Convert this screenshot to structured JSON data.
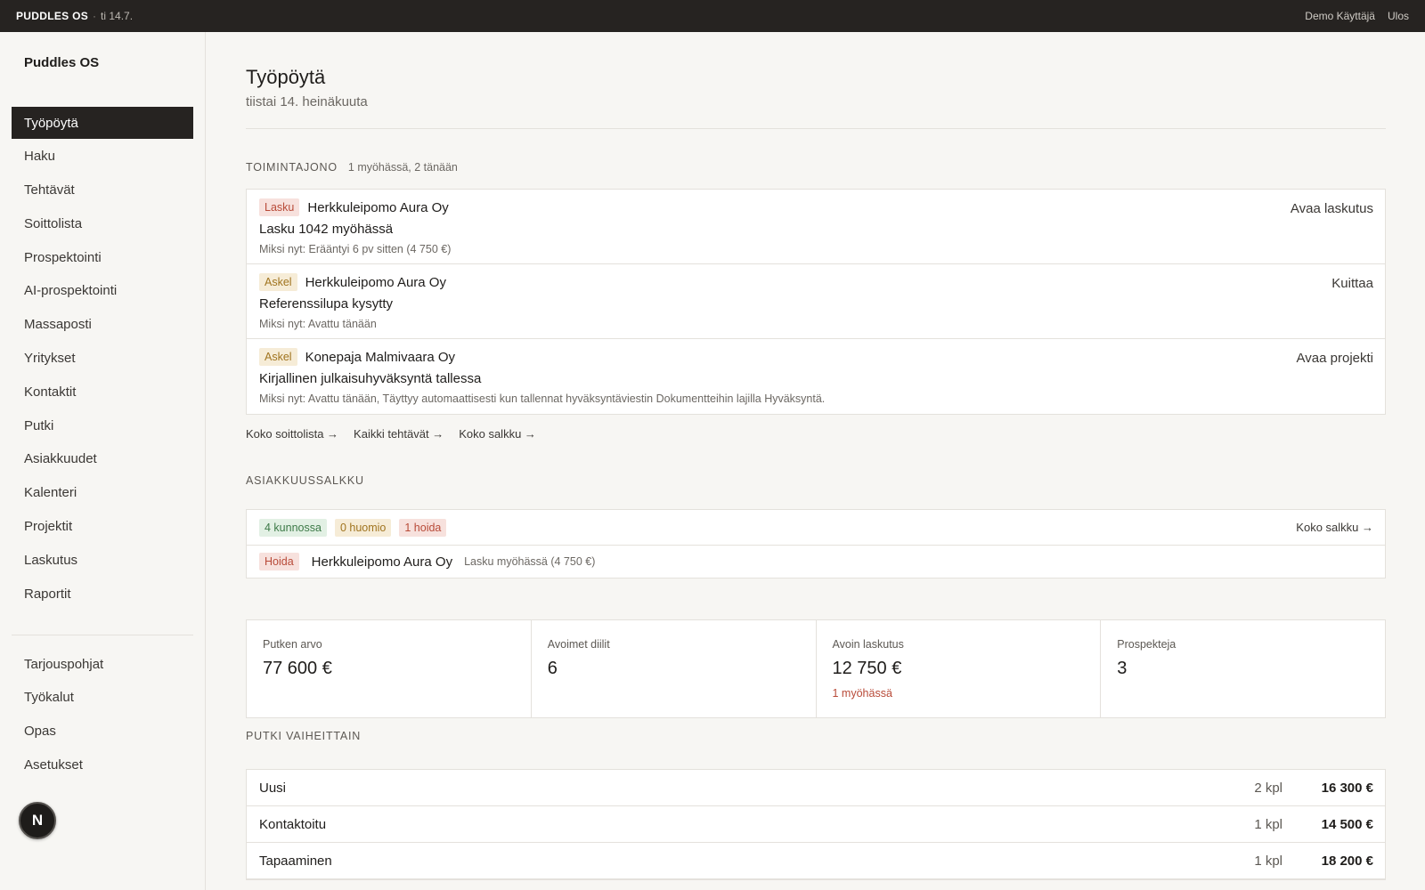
{
  "topbar": {
    "brand": "PUDDLES OS",
    "separator": "·",
    "date": "ti 14.7.",
    "user": "Demo Käyttäjä",
    "logout": "Ulos"
  },
  "sidebar": {
    "app_name": "Puddles OS",
    "items": [
      {
        "label": "Työpöytä",
        "active": true
      },
      {
        "label": "Haku"
      },
      {
        "label": "Tehtävät"
      },
      {
        "label": "Soittolista"
      },
      {
        "label": "Prospektointi"
      },
      {
        "label": "AI-prospektointi"
      },
      {
        "label": "Massaposti"
      },
      {
        "label": "Yritykset"
      },
      {
        "label": "Kontaktit"
      },
      {
        "label": "Putki"
      },
      {
        "label": "Asiakkuudet"
      },
      {
        "label": "Kalenteri"
      },
      {
        "label": "Projektit"
      },
      {
        "label": "Laskutus"
      },
      {
        "label": "Raportit"
      }
    ],
    "secondary": [
      {
        "label": "Tarjouspohjat"
      },
      {
        "label": "Työkalut"
      },
      {
        "label": "Opas"
      },
      {
        "label": "Asetukset"
      }
    ],
    "badge": "N"
  },
  "page": {
    "title": "Työpöytä",
    "subtitle": "tiistai 14. heinäkuuta"
  },
  "queue": {
    "label": "TOIMINTAJONO",
    "meta": "1 myöhässä, 2 tänään",
    "items": [
      {
        "tag": "Lasku",
        "company": "Herkkuleipomo Aura Oy",
        "title": "Lasku 1042 myöhässä",
        "why": "Miksi nyt: Erääntyi 6 pv sitten (4 750 €)",
        "action": "Avaa laskutus"
      },
      {
        "tag": "Askel",
        "company": "Herkkuleipomo Aura Oy",
        "title": "Referenssilupa kysytty",
        "why": "Miksi nyt: Avattu tänään",
        "action": "Kuittaa"
      },
      {
        "tag": "Askel",
        "company": "Konepaja Malmivaara Oy",
        "title": "Kirjallinen julkaisuhyväksyntä tallessa",
        "why": "Miksi nyt: Avattu tänään, Täyttyy automaattisesti kun tallennat hyväksyntäviestin Dokumentteihin lajilla Hyväksyntä.",
        "action": "Avaa projekti"
      }
    ],
    "links": [
      "Koko soittolista →",
      "Kaikki tehtävät →",
      "Koko salkku →"
    ]
  },
  "portfolio": {
    "label": "ASIAKKUUSSALKKU",
    "tags": [
      "4 kunnossa",
      "0 huomio",
      "1 hoida"
    ],
    "link": "Koko salkku →",
    "row": {
      "tag": "Hoida",
      "company": "Herkkuleipomo Aura Oy",
      "note": "Lasku myöhässä (4 750 €)"
    }
  },
  "stats": [
    {
      "label": "Putken arvo",
      "value": "77 600 €"
    },
    {
      "label": "Avoimet diilit",
      "value": "6"
    },
    {
      "label": "Avoin laskutus",
      "value": "12 750 €",
      "sub": "1 myöhässä"
    },
    {
      "label": "Prospekteja",
      "value": "3"
    }
  ],
  "pipeline": {
    "label": "PUTKI VAIHEITTAIN",
    "rows": [
      {
        "name": "Uusi",
        "count": "2 kpl",
        "amount": "16 300 €"
      },
      {
        "name": "Kontaktoitu",
        "count": "1 kpl",
        "amount": "14 500 €"
      },
      {
        "name": "Tapaaminen",
        "count": "1 kpl",
        "amount": "18 200 €"
      }
    ]
  }
}
